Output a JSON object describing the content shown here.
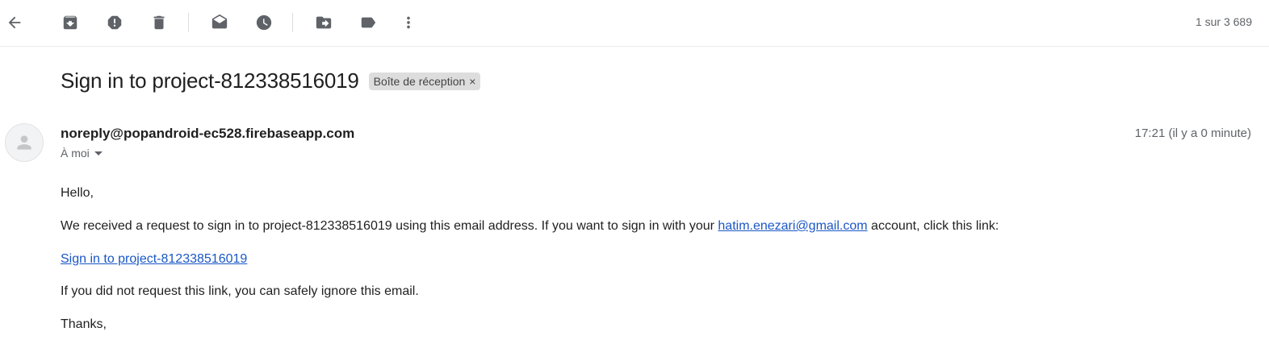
{
  "toolbar": {
    "icons": [
      "back-arrow-icon",
      "archive-icon",
      "report-spam-icon",
      "delete-icon",
      "mark-unread-icon",
      "snooze-icon",
      "move-to-icon",
      "label-icon",
      "more-vert-icon"
    ],
    "pager": "1 sur 3 689"
  },
  "subject": {
    "title": "Sign in to project-812338516019",
    "label": "Boîte de réception",
    "label_close": "×"
  },
  "header": {
    "sender": "noreply@popandroid-ec528.firebaseapp.com",
    "recipient": "À moi",
    "time": "17:21 (il y a 0 minute)"
  },
  "body": {
    "greeting": "Hello,",
    "p1_before": "We received a request to sign in to project-812338516019 using this email address. If you want to sign in with your ",
    "p1_email": "hatim.enezari@gmail.com",
    "p1_after": " account, click this link:",
    "signin_link": "Sign in to project-812338516019",
    "p2": "If you did not request this link, you can safely ignore this email.",
    "closing": "Thanks,"
  },
  "colors": {
    "icon": "#5f6368",
    "link": "#1a57c6",
    "chip_bg": "#dddddd",
    "text": "#1f1f1f"
  }
}
